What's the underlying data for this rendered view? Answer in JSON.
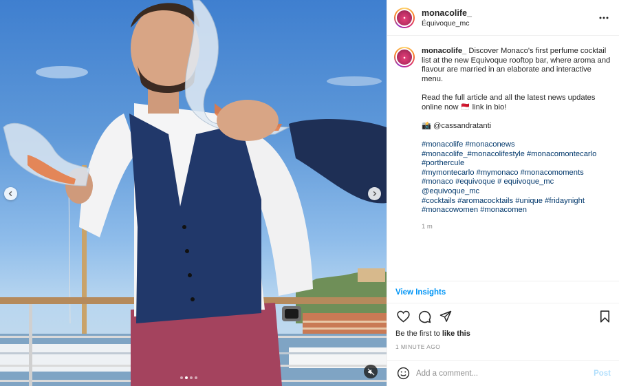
{
  "header": {
    "username": "monacolife_",
    "location": "Équivoque_mc",
    "more_icon": "more-horizontal-icon"
  },
  "caption": {
    "username": "monacolife_",
    "intro": "Discover Monaco's first perfume cocktail list at the new Equivoque rooftop bar, where aroma and flavour are married in an elaborate and interactive menu.",
    "paragraph2": "Read the full article and all the latest news updates online now 🇲🇨 link in bio!",
    "credit": "📸 @cassandratanti",
    "hashtags": [
      "#monacolife",
      "#monaconews",
      "#monacolife_#monacolifestyle",
      "#monacomontecarlo",
      "#porthercule",
      "#mymontecarlo",
      "#mymonaco",
      "#monacomoments",
      "#monaco",
      "#equivoque",
      "# equivoque_mc",
      "@equivoque_mc",
      "#cocktails",
      "#aromacocktails",
      "#unique",
      "#fridaynight",
      "#monacowomen",
      "#monacomen"
    ],
    "time": "1 m"
  },
  "insights_label": "View Insights",
  "actions": {
    "like_icon": "heart-icon",
    "comment_icon": "comment-icon",
    "share_icon": "send-icon",
    "save_icon": "bookmark-icon"
  },
  "likes": {
    "prefix": "Be the first to",
    "link": "like this"
  },
  "post_time": "1 MINUTE AGO",
  "comment": {
    "placeholder": "Add a comment...",
    "post_label": "Post"
  },
  "media": {
    "carousel_count": 4,
    "carousel_active": 1
  }
}
